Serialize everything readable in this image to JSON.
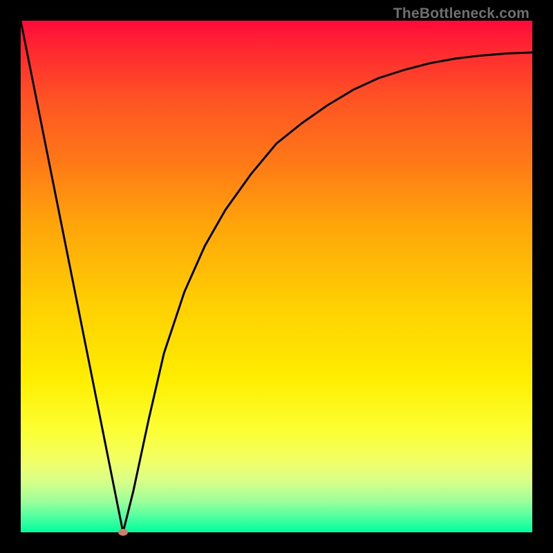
{
  "site": {
    "watermark": "TheBottleneck.com"
  },
  "colors": {
    "frame": "#000000",
    "marker": "#cf7f70",
    "curve": "#000000"
  },
  "chart_data": {
    "type": "line",
    "title": "",
    "xlabel": "",
    "ylabel": "",
    "xlim": [
      0,
      100
    ],
    "ylim": [
      0,
      100
    ],
    "legend": false,
    "grid": false,
    "axes_visible": false,
    "series": [
      {
        "name": "curve",
        "x": [
          0,
          5,
          10,
          15,
          18,
          20,
          22,
          25,
          28,
          32,
          36,
          40,
          45,
          50,
          55,
          60,
          65,
          70,
          75,
          80,
          85,
          90,
          95,
          100
        ],
        "y": [
          100,
          75,
          50,
          25,
          10,
          0,
          8,
          22,
          35,
          47,
          56,
          63,
          70,
          76,
          80,
          83.5,
          86.5,
          88.8,
          90.4,
          91.7,
          92.6,
          93.2,
          93.6,
          93.8
        ]
      }
    ],
    "marker": {
      "x": 20,
      "y": 0
    },
    "background_gradient": {
      "direction": "vertical",
      "stops": [
        {
          "pos": 0.0,
          "color": "#ff0a3b"
        },
        {
          "pos": 0.04,
          "color": "#ff2033"
        },
        {
          "pos": 0.15,
          "color": "#ff5224"
        },
        {
          "pos": 0.28,
          "color": "#ff7a16"
        },
        {
          "pos": 0.4,
          "color": "#ffa50a"
        },
        {
          "pos": 0.55,
          "color": "#ffce03"
        },
        {
          "pos": 0.7,
          "color": "#feee00"
        },
        {
          "pos": 0.8,
          "color": "#fcff33"
        },
        {
          "pos": 0.86,
          "color": "#f2ff66"
        },
        {
          "pos": 0.9,
          "color": "#d8ff88"
        },
        {
          "pos": 0.94,
          "color": "#9cff9a"
        },
        {
          "pos": 0.97,
          "color": "#4effa0"
        },
        {
          "pos": 1.0,
          "color": "#00ff9e"
        }
      ]
    }
  }
}
